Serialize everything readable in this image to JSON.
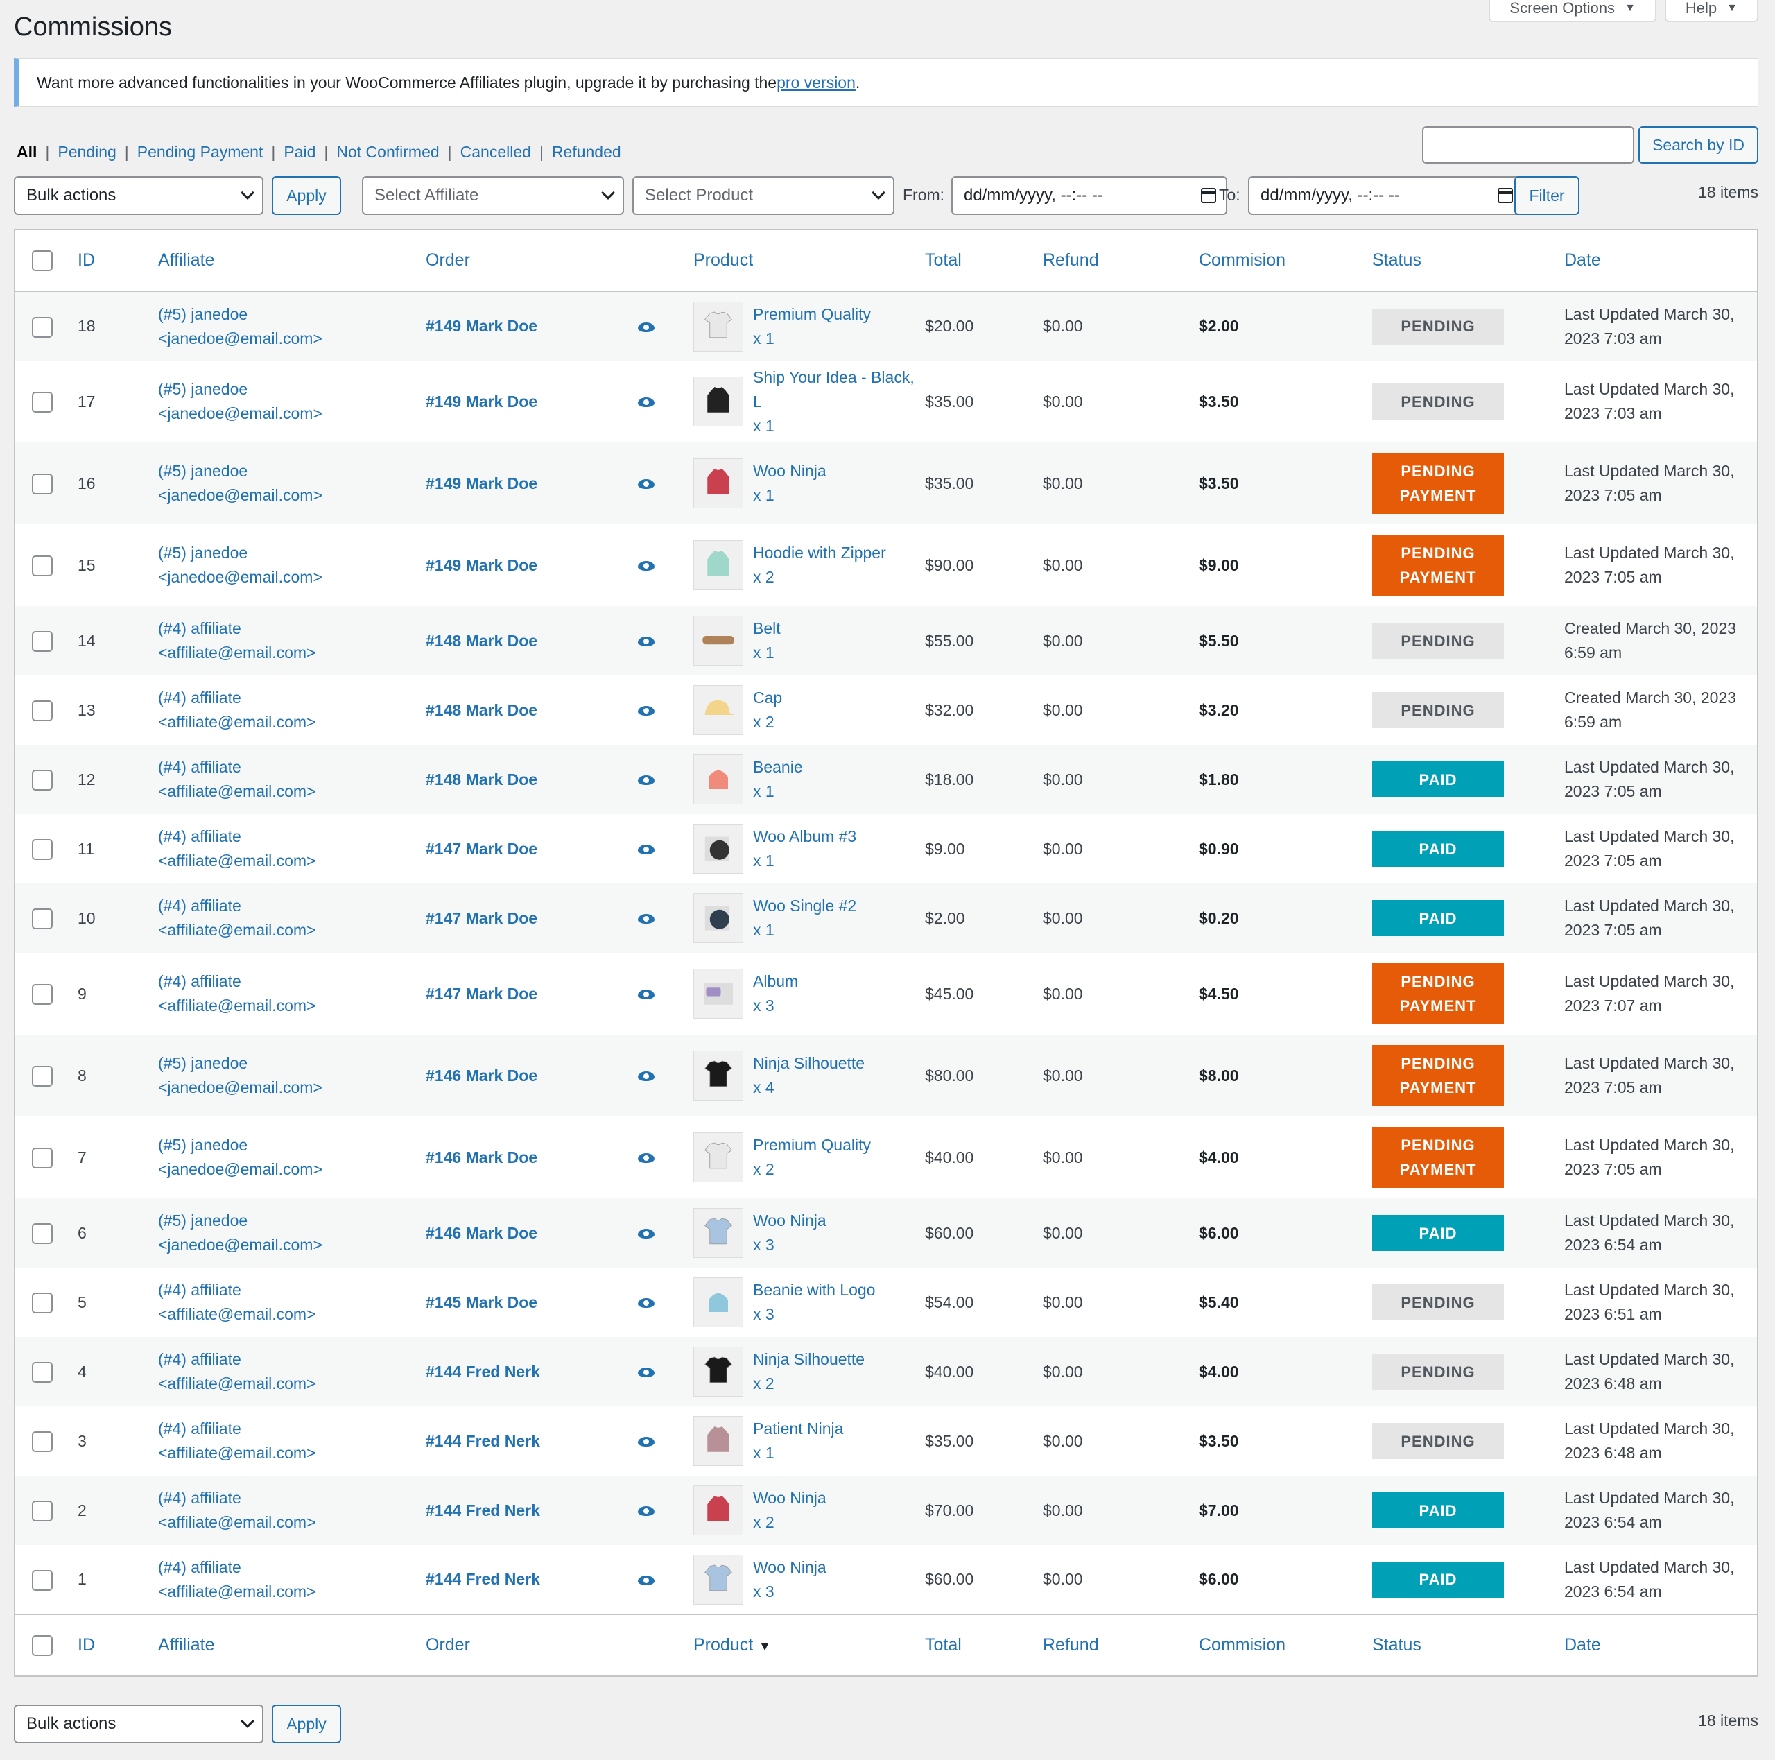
{
  "header": {
    "screen_options": "Screen Options",
    "help": "Help",
    "title": "Commissions"
  },
  "notice": {
    "text": "Want more advanced functionalities in your WooCommerce Affiliates plugin, upgrade it by purchasing the ",
    "link": "pro version",
    "end": "."
  },
  "views": {
    "all": "All",
    "pending": "Pending",
    "pending_payment": "Pending Payment",
    "paid": "Paid",
    "not_confirmed": "Not Confirmed",
    "cancelled": "Cancelled",
    "refunded": "Refunded",
    "separator": "|"
  },
  "search": {
    "button": "Search by ID",
    "value": ""
  },
  "filters": {
    "bulk_actions": "Bulk actions",
    "apply": "Apply",
    "select_affiliate": "Select Affiliate",
    "select_product": "Select Product",
    "from_label": "From:",
    "to_label": "To:",
    "date_placeholder": "dd/mm/yyyy, --:-- --",
    "filter": "Filter",
    "items_count": "18 items"
  },
  "columns": {
    "id": "ID",
    "affiliate": "Affiliate",
    "order": "Order",
    "product": "Product",
    "total": "Total",
    "refund": "Refund",
    "commission": "Commision",
    "status": "Status",
    "date": "Date"
  },
  "rows": [
    {
      "id": "18",
      "aff1": "(#5) janedoe",
      "aff2": "<janedoe@email.com>",
      "order": "#149 Mark Doe",
      "product": "Premium Quality",
      "qty": "x 1",
      "total": "$20.00",
      "refund": "$0.00",
      "commission": "$2.00",
      "status": "PENDING",
      "status_type": "pending",
      "date": "Last Updated March 30, 2023 7:03 am",
      "thumb": "tshirt-white-icon",
      "thumb_color": "#e8e8e8"
    },
    {
      "id": "17",
      "aff1": "(#5) janedoe",
      "aff2": "<janedoe@email.com>",
      "order": "#149 Mark Doe",
      "product": "Ship Your Idea - Black, L",
      "qty": "x 1",
      "total": "$35.00",
      "refund": "$0.00",
      "commission": "$3.50",
      "status": "PENDING",
      "status_type": "pending",
      "date": "Last Updated March 30, 2023 7:03 am",
      "thumb": "hoodie-black-icon",
      "thumb_color": "#222222"
    },
    {
      "id": "16",
      "aff1": "(#5) janedoe",
      "aff2": "<janedoe@email.com>",
      "order": "#149 Mark Doe",
      "product": "Woo Ninja",
      "qty": "x 1",
      "total": "$35.00",
      "refund": "$0.00",
      "commission": "$3.50",
      "status": "PENDING PAYMENT",
      "status_type": "ppay",
      "date": "Last Updated March 30, 2023 7:05 am",
      "thumb": "hoodie-red-icon",
      "thumb_color": "#c9414e"
    },
    {
      "id": "15",
      "aff1": "(#5) janedoe",
      "aff2": "<janedoe@email.com>",
      "order": "#149 Mark Doe",
      "product": "Hoodie with Zipper",
      "qty": "x 2",
      "total": "$90.00",
      "refund": "$0.00",
      "commission": "$9.00",
      "status": "PENDING PAYMENT",
      "status_type": "ppay",
      "date": "Last Updated March 30, 2023 7:05 am",
      "thumb": "hoodie-mint-icon",
      "thumb_color": "#9fd8cb"
    },
    {
      "id": "14",
      "aff1": "(#4) affiliate",
      "aff2": "<affiliate@email.com>",
      "order": "#148 Mark Doe",
      "product": "Belt",
      "qty": "x 1",
      "total": "$55.00",
      "refund": "$0.00",
      "commission": "$5.50",
      "status": "PENDING",
      "status_type": "pending",
      "date": "Created March 30, 2023 6:59 am",
      "thumb": "belt-icon",
      "thumb_color": "#b0825a"
    },
    {
      "id": "13",
      "aff1": "(#4) affiliate",
      "aff2": "<affiliate@email.com>",
      "order": "#148 Mark Doe",
      "product": "Cap",
      "qty": "x 2",
      "total": "$32.00",
      "refund": "$0.00",
      "commission": "$3.20",
      "status": "PENDING",
      "status_type": "pending",
      "date": "Created March 30, 2023 6:59 am",
      "thumb": "cap-icon",
      "thumb_color": "#f2d58a"
    },
    {
      "id": "12",
      "aff1": "(#4) affiliate",
      "aff2": "<affiliate@email.com>",
      "order": "#148 Mark Doe",
      "product": "Beanie",
      "qty": "x 1",
      "total": "$18.00",
      "refund": "$0.00",
      "commission": "$1.80",
      "status": "PAID",
      "status_type": "paid",
      "date": "Last Updated March 30, 2023 7:05 am",
      "thumb": "beanie-icon",
      "thumb_color": "#f08a7a"
    },
    {
      "id": "11",
      "aff1": "(#4) affiliate",
      "aff2": "<affiliate@email.com>",
      "order": "#147 Mark Doe",
      "product": "Woo Album #3",
      "qty": "x 1",
      "total": "$9.00",
      "refund": "$0.00",
      "commission": "$0.90",
      "status": "PAID",
      "status_type": "paid",
      "date": "Last Updated March 30, 2023 7:05 am",
      "thumb": "album-icon",
      "thumb_color": "#333333"
    },
    {
      "id": "10",
      "aff1": "(#4) affiliate",
      "aff2": "<affiliate@email.com>",
      "order": "#147 Mark Doe",
      "product": "Woo Single #2",
      "qty": "x 1",
      "total": "$2.00",
      "refund": "$0.00",
      "commission": "$0.20",
      "status": "PAID",
      "status_type": "paid",
      "date": "Last Updated March 30, 2023 7:05 am",
      "thumb": "single-icon",
      "thumb_color": "#2f3f4f"
    },
    {
      "id": "9",
      "aff1": "(#4) affiliate",
      "aff2": "<affiliate@email.com>",
      "order": "#147 Mark Doe",
      "product": "Album",
      "qty": "x 3",
      "total": "$45.00",
      "refund": "$0.00",
      "commission": "$4.50",
      "status": "PENDING PAYMENT",
      "status_type": "ppay",
      "date": "Last Updated March 30, 2023 7:07 am",
      "thumb": "woo-album-icon",
      "thumb_color": "#a08ec5"
    },
    {
      "id": "8",
      "aff1": "(#5) janedoe",
      "aff2": "<janedoe@email.com>",
      "order": "#146 Mark Doe",
      "product": "Ninja Silhouette",
      "qty": "x 4",
      "total": "$80.00",
      "refund": "$0.00",
      "commission": "$8.00",
      "status": "PENDING PAYMENT",
      "status_type": "ppay",
      "date": "Last Updated March 30, 2023 7:05 am",
      "thumb": "tshirt-black-icon",
      "thumb_color": "#1a1a1a"
    },
    {
      "id": "7",
      "aff1": "(#5) janedoe",
      "aff2": "<janedoe@email.com>",
      "order": "#146 Mark Doe",
      "product": "Premium Quality",
      "qty": "x 2",
      "total": "$40.00",
      "refund": "$0.00",
      "commission": "$4.00",
      "status": "PENDING PAYMENT",
      "status_type": "ppay",
      "date": "Last Updated March 30, 2023 7:05 am",
      "thumb": "tshirt-white-icon",
      "thumb_color": "#e8e8e8"
    },
    {
      "id": "6",
      "aff1": "(#5) janedoe",
      "aff2": "<janedoe@email.com>",
      "order": "#146 Mark Doe",
      "product": "Woo Ninja",
      "qty": "x 3",
      "total": "$60.00",
      "refund": "$0.00",
      "commission": "$6.00",
      "status": "PAID",
      "status_type": "paid",
      "date": "Last Updated March 30, 2023 6:54 am",
      "thumb": "tshirt-blue-icon",
      "thumb_color": "#a9c4e0"
    },
    {
      "id": "5",
      "aff1": "(#4) affiliate",
      "aff2": "<affiliate@email.com>",
      "order": "#145 Mark Doe",
      "product": "Beanie with Logo",
      "qty": "x 3",
      "total": "$54.00",
      "refund": "$0.00",
      "commission": "$5.40",
      "status": "PENDING",
      "status_type": "pending",
      "date": "Last Updated March 30, 2023 6:51 am",
      "thumb": "beanie-blue-icon",
      "thumb_color": "#8fc7dc"
    },
    {
      "id": "4",
      "aff1": "(#4) affiliate",
      "aff2": "<affiliate@email.com>",
      "order": "#144 Fred Nerk",
      "product": "Ninja Silhouette",
      "qty": "x 2",
      "total": "$40.00",
      "refund": "$0.00",
      "commission": "$4.00",
      "status": "PENDING",
      "status_type": "pending",
      "date": "Last Updated March 30, 2023 6:48 am",
      "thumb": "tshirt-black-icon",
      "thumb_color": "#1a1a1a"
    },
    {
      "id": "3",
      "aff1": "(#4) affiliate",
      "aff2": "<affiliate@email.com>",
      "order": "#144 Fred Nerk",
      "product": "Patient Ninja",
      "qty": "x 1",
      "total": "$35.00",
      "refund": "$0.00",
      "commission": "$3.50",
      "status": "PENDING",
      "status_type": "pending",
      "date": "Last Updated March 30, 2023 6:48 am",
      "thumb": "hoodie-pink-icon",
      "thumb_color": "#b89097"
    },
    {
      "id": "2",
      "aff1": "(#4) affiliate",
      "aff2": "<affiliate@email.com>",
      "order": "#144 Fred Nerk",
      "product": "Woo Ninja",
      "qty": "x 2",
      "total": "$70.00",
      "refund": "$0.00",
      "commission": "$7.00",
      "status": "PAID",
      "status_type": "paid",
      "date": "Last Updated March 30, 2023 6:54 am",
      "thumb": "hoodie-red-icon",
      "thumb_color": "#c9414e"
    },
    {
      "id": "1",
      "aff1": "(#4) affiliate",
      "aff2": "<affiliate@email.com>",
      "order": "#144 Fred Nerk",
      "product": "Woo Ninja",
      "qty": "x 3",
      "total": "$60.00",
      "refund": "$0.00",
      "commission": "$6.00",
      "status": "PAID",
      "status_type": "paid",
      "date": "Last Updated March 30, 2023 6:54 am",
      "thumb": "tshirt-blue-icon",
      "thumb_color": "#a9c4e0"
    }
  ],
  "footer": {
    "product_sort_indicator": "▼",
    "bulk_actions": "Bulk actions",
    "apply": "Apply",
    "items_count": "18 items"
  },
  "colors": {
    "link": "#2271b1",
    "pending_payment": "#e65b08",
    "paid": "#00a0b6",
    "pending": "#e5e5e5"
  }
}
